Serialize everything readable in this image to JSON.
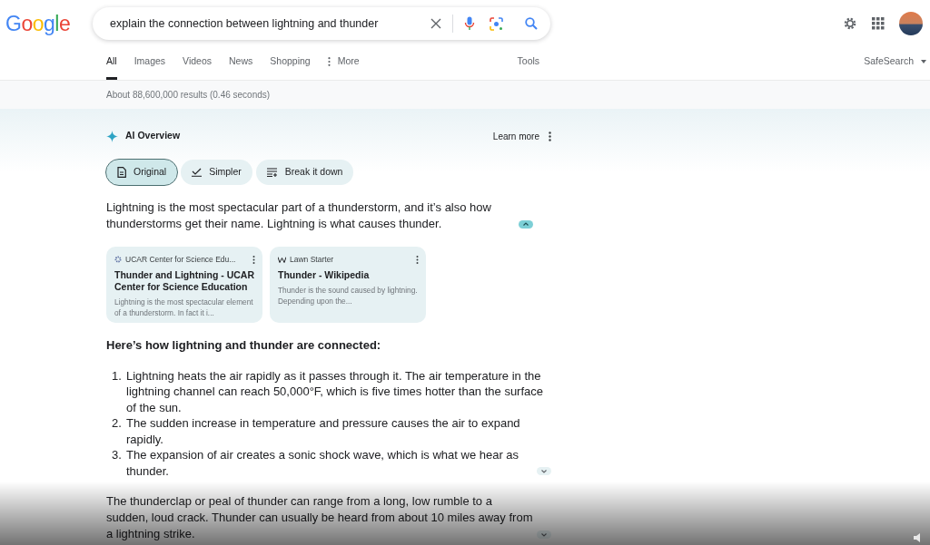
{
  "logo": "Google",
  "search": {
    "value": "explain the connection between lightning and thunder"
  },
  "tabs": [
    {
      "label": "All",
      "selected": true
    },
    {
      "label": "Images",
      "selected": false
    },
    {
      "label": "Videos",
      "selected": false
    },
    {
      "label": "News",
      "selected": false
    },
    {
      "label": "Shopping",
      "selected": false
    },
    {
      "label": "More",
      "selected": false,
      "kind": "menu"
    }
  ],
  "tools": "Tools",
  "safesearch": "SafeSearch",
  "result_stats": "About 88,600,000 results (0.46 seconds)",
  "ai_overview": {
    "title": "AI Overview",
    "learn_more": "Learn more",
    "modes": [
      {
        "label": "Original",
        "kind": "doc",
        "selected": true
      },
      {
        "label": "Simpler",
        "kind": "check",
        "selected": false
      },
      {
        "label": "Break it down",
        "kind": "list",
        "selected": false
      }
    ],
    "intro": {
      "text": "Lightning is the most spectacular part of a thunderstorm, and it’s also how thunderstorms get their name. Lightning is what causes thunder.",
      "expanded": true
    },
    "sources": [
      {
        "site": "UCAR Center for Science Edu...",
        "kind": "gear",
        "title": "Thunder and Lightning - UCAR Center for Science Education",
        "snippet": "Lightning is the most spectacular element of a thunderstorm. In fact it i..."
      },
      {
        "site": "Lawn Starter",
        "kind": "wiki",
        "title": "Thunder - Wikipedia",
        "snippet": "Thunder is the sound caused by lightning. Depending upon the..."
      }
    ],
    "heading": "Here’s how lightning and thunder are connected:",
    "steps": [
      {
        "number": "1.",
        "text": "Lightning heats the air rapidly as it passes through it. The air temperature in the lightning channel can reach 50,000°F, which is five times hotter than the surface of the sun."
      },
      {
        "number": "2.",
        "text": "The sudden increase in temperature and pressure causes the air to expand rapidly."
      },
      {
        "number": "3.",
        "text": "The expansion of air creates a sonic shock wave, which is what we hear as thunder.",
        "expanded": false
      }
    ],
    "closing": {
      "text": "The thunderclap or peal of thunder can range from a long, low rumble to a sudden, loud crack. Thunder can usually be heard from about 10 miles away from a lightning strike.",
      "expanded": false
    }
  }
}
